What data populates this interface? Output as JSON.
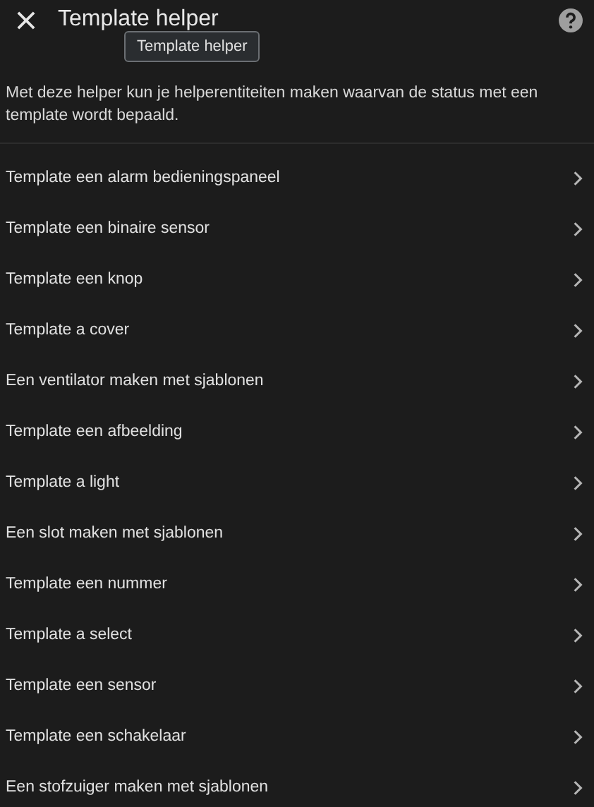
{
  "header": {
    "title": "Template helper",
    "tooltip": "Template helper"
  },
  "description": "Met deze helper kun je helperentiteiten maken waarvan de status met een template wordt bepaald.",
  "items": [
    {
      "label": "Template een alarm bedieningspaneel"
    },
    {
      "label": "Template een binaire sensor"
    },
    {
      "label": "Template een knop"
    },
    {
      "label": "Template a cover"
    },
    {
      "label": "Een ventilator maken met sjablonen"
    },
    {
      "label": "Template een afbeelding"
    },
    {
      "label": "Template a light"
    },
    {
      "label": "Een slot maken met sjablonen"
    },
    {
      "label": "Template een nummer"
    },
    {
      "label": "Template a select"
    },
    {
      "label": "Template een sensor"
    },
    {
      "label": "Template een schakelaar"
    },
    {
      "label": "Een stofzuiger maken met sjablonen"
    }
  ]
}
